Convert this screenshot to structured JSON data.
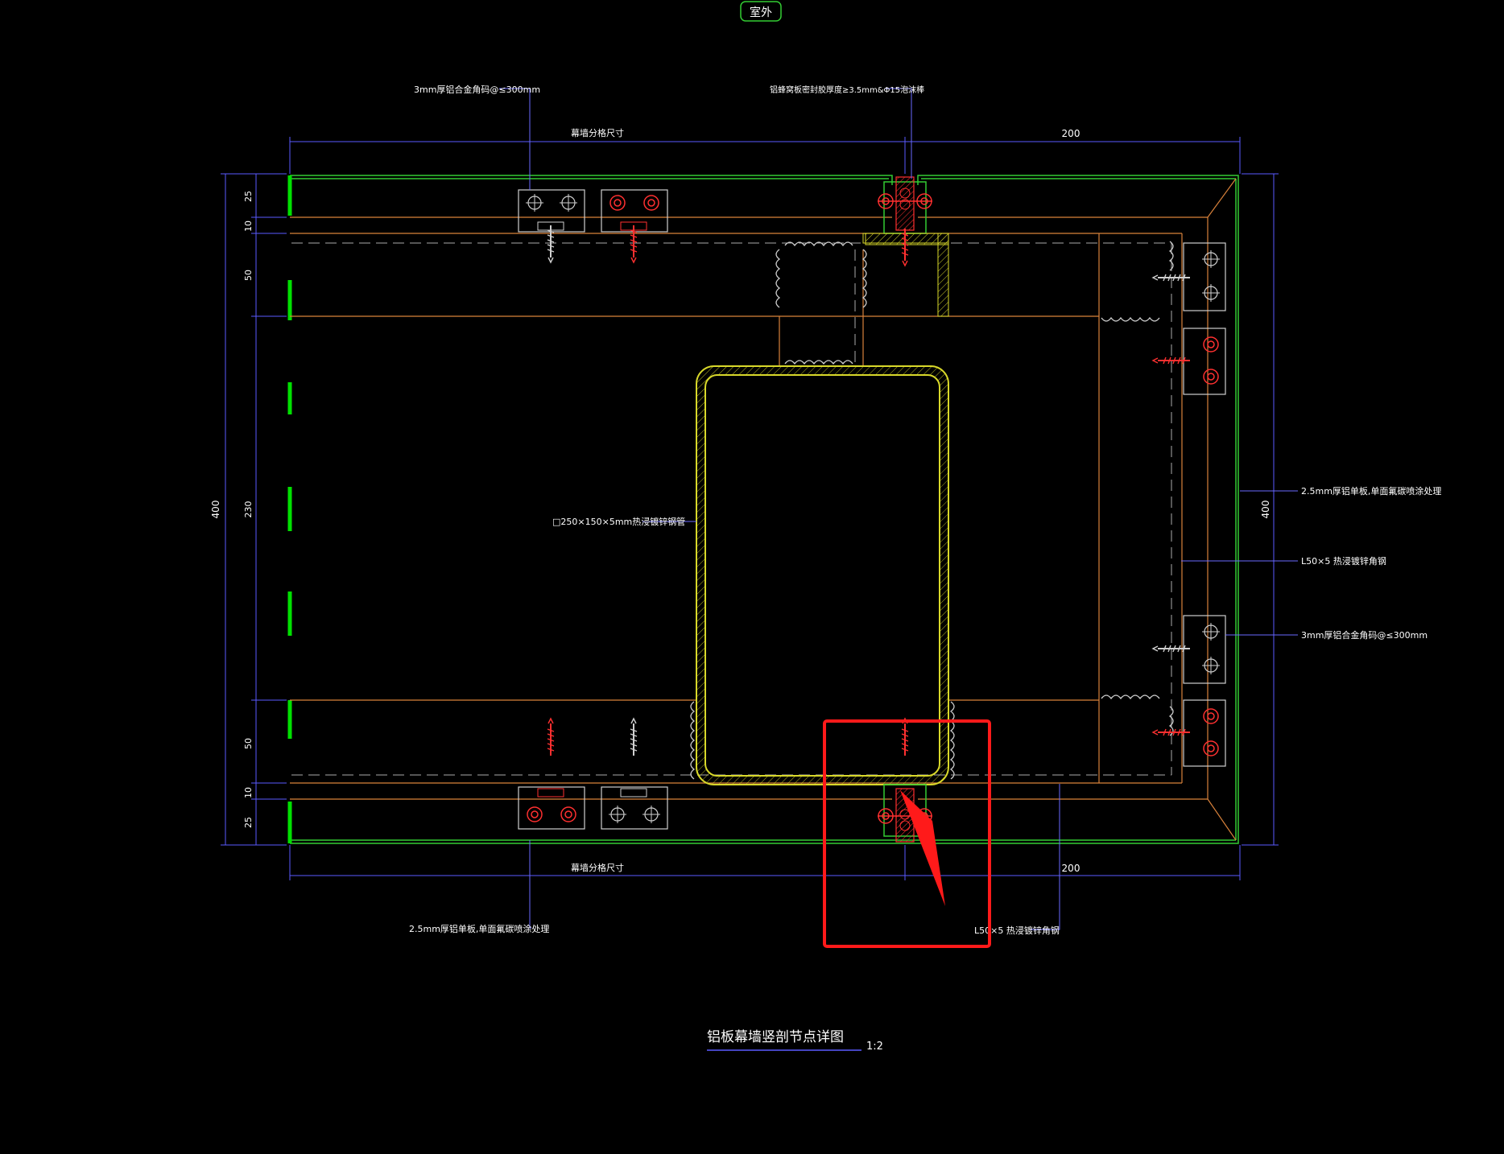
{
  "drawing": {
    "outside_label": "室外",
    "title": "铝板幕墙竖剖节点详图",
    "scale": "1:2"
  },
  "dimensions": {
    "top_left_text": "幕墙分格尺寸",
    "top_right_value": "200",
    "bottom_left_text": "幕墙分格尺寸",
    "bottom_right_value": "200",
    "left_total": "400",
    "left_seg_top_25": "25",
    "left_seg_top_10": "10",
    "left_seg_top_50": "50",
    "left_seg_mid_230": "230",
    "left_seg_bot_50": "50",
    "left_seg_bot_10": "10",
    "left_seg_bot_25": "25",
    "right_total": "400"
  },
  "callouts": {
    "top_left": "3mm厚铝合金角码@≤300mm",
    "top_center": "铝蜂窝板密封胶厚度≥3.5mm&Φ15泡沫棒",
    "center_tube": "□250×150×5mm热浸镀锌钢管",
    "right_panel": "2.5mm厚铝单板,单面氟碳喷涂处理",
    "right_angle": "L50×5 热浸镀锌角钢",
    "right_clip": "3mm厚铝合金角码@≤300mm",
    "bottom_left": "2.5mm厚铝单板,单面氟碳喷涂处理",
    "bottom_right": "L50×5 热浸镀锌角钢"
  },
  "colors": {
    "background": "#000000",
    "panel_green": "#33cc33",
    "bright_green": "#00e000",
    "steel_orange": "#d9823b",
    "tube_yellow": "#d8d82a",
    "dimension_blue": "#5a5aff",
    "leader_blue": "#6a6aff",
    "bolt_red": "#ff3030",
    "bracket_white": "#cfcfcf",
    "highlight_red": "#ff1a1a"
  }
}
